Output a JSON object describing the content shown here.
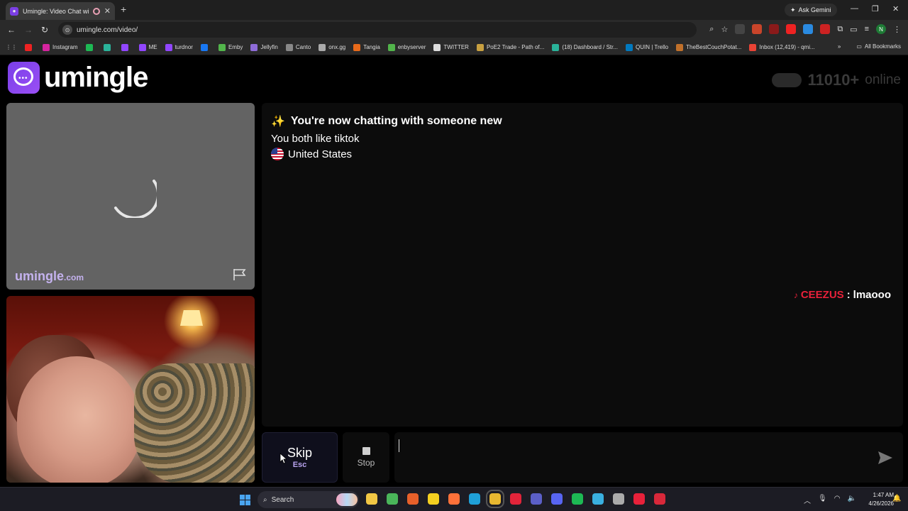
{
  "browser": {
    "tab_title": "Umingle: Video Chat with S",
    "new_tab": "+",
    "gemini": "Ask Gemini",
    "url": "umingle.com/video/",
    "bookmarks": [
      {
        "label": "",
        "color": "#e22"
      },
      {
        "label": "Instagram",
        "color": "#d6249f"
      },
      {
        "label": "",
        "color": "#1db954"
      },
      {
        "label": "",
        "color": "#2ab39a"
      },
      {
        "label": "",
        "color": "#9146ff"
      },
      {
        "label": "ME",
        "color": "#9146ff"
      },
      {
        "label": "turdnor",
        "color": "#9146ff"
      },
      {
        "label": "",
        "color": "#1877f2"
      },
      {
        "label": "Emby",
        "color": "#52b54b"
      },
      {
        "label": "Jellyfin",
        "color": "#8e6cd8"
      },
      {
        "label": "Canto",
        "color": "#888"
      },
      {
        "label": "onx.gg",
        "color": "#aaa"
      },
      {
        "label": "Tangia",
        "color": "#e86a1a"
      },
      {
        "label": "enbyserver",
        "color": "#52b54b"
      },
      {
        "label": "TWITTER",
        "color": "#ddd"
      },
      {
        "label": "PoE2 Trade - Path of...",
        "color": "#c8a040"
      },
      {
        "label": "(18) Dashboard / Str...",
        "color": "#2ab39a"
      },
      {
        "label": "QUIN | Trello",
        "color": "#0079bf"
      },
      {
        "label": "TheBestCouchPotat...",
        "color": "#c0702a"
      },
      {
        "label": "Inbox (12,419) - qmi...",
        "color": "#ea4335"
      }
    ],
    "all_bookmarks": "All Bookmarks",
    "profile_initial": "N"
  },
  "page": {
    "logo_text": "umingle",
    "online_count": "11010+",
    "online_word": "online",
    "watermark": "umingle",
    "watermark_suffix": ".com"
  },
  "chat": {
    "system_title": "You're now chatting with someone new",
    "system_interest": "You both like tiktok",
    "system_country": "United States",
    "overlay_name": "CEEZUS",
    "overlay_sep": ":",
    "overlay_text": "lmaooo"
  },
  "controls": {
    "skip_label": "Skip",
    "skip_key": "Esc",
    "stop_label": "Stop",
    "message_value": ""
  },
  "taskbar": {
    "search_label": "Search",
    "time": "1:47 AM",
    "date": "4/26/2026",
    "apps": [
      {
        "name": "file-explorer",
        "color": "#f2c744"
      },
      {
        "name": "media-player",
        "color": "#4ab55a"
      },
      {
        "name": "app-orange",
        "color": "#e8602a"
      },
      {
        "name": "sticky-notes",
        "color": "#f5d020"
      },
      {
        "name": "firefox",
        "color": "#ff7139"
      },
      {
        "name": "edge",
        "color": "#1fa0d8"
      },
      {
        "name": "chrome",
        "color": "#e8b830"
      },
      {
        "name": "opera",
        "color": "#e2243a"
      },
      {
        "name": "teams",
        "color": "#5b5fc7"
      },
      {
        "name": "discord",
        "color": "#5865f2"
      },
      {
        "name": "spotify",
        "color": "#1db954"
      },
      {
        "name": "notepad",
        "color": "#3ab0e0"
      },
      {
        "name": "clock",
        "color": "#aaaaaa"
      },
      {
        "name": "tiktok",
        "color": "#e8213a"
      },
      {
        "name": "app-red",
        "color": "#d8283a"
      }
    ]
  }
}
